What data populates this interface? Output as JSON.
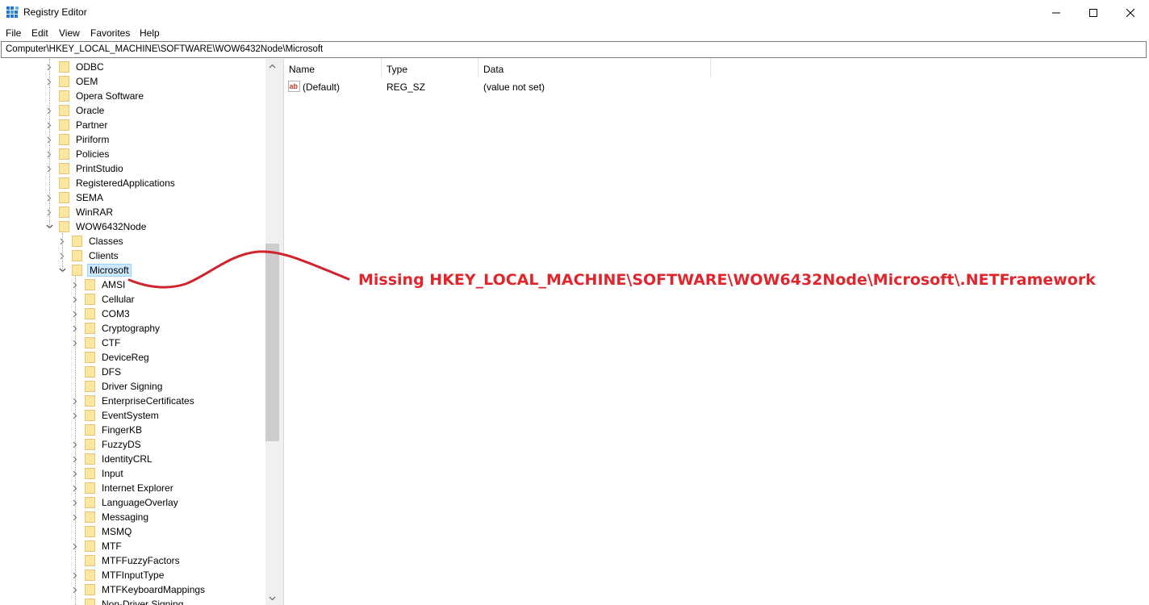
{
  "window": {
    "title": "Registry Editor",
    "minimize_icon": "minimize-icon",
    "maximize_icon": "maximize-icon",
    "close_icon": "close-icon"
  },
  "menu": [
    "File",
    "Edit",
    "View",
    "Favorites",
    "Help"
  ],
  "address": "Computer\\HKEY_LOCAL_MACHINE\\SOFTWARE\\WOW6432Node\\Microsoft",
  "tree": {
    "level1": [
      {
        "label": "ODBC",
        "expandable": true
      },
      {
        "label": "OEM",
        "expandable": true
      },
      {
        "label": "Opera Software",
        "expandable": false
      },
      {
        "label": "Oracle",
        "expandable": true
      },
      {
        "label": "Partner",
        "expandable": true
      },
      {
        "label": "Piriform",
        "expandable": true
      },
      {
        "label": "Policies",
        "expandable": true
      },
      {
        "label": "PrintStudio",
        "expandable": true
      },
      {
        "label": "RegisteredApplications",
        "expandable": false
      },
      {
        "label": "SEMA",
        "expandable": true
      },
      {
        "label": "WinRAR",
        "expandable": true
      },
      {
        "label": "WOW6432Node",
        "expandable": true,
        "expanded": true
      }
    ],
    "level2": [
      {
        "label": "Classes",
        "expandable": true
      },
      {
        "label": "Clients",
        "expandable": true
      },
      {
        "label": "Microsoft",
        "expandable": true,
        "expanded": true,
        "selected": true
      }
    ],
    "level3": [
      {
        "label": "AMSI",
        "expandable": true
      },
      {
        "label": "Cellular",
        "expandable": true
      },
      {
        "label": "COM3",
        "expandable": true
      },
      {
        "label": "Cryptography",
        "expandable": true
      },
      {
        "label": "CTF",
        "expandable": true
      },
      {
        "label": "DeviceReg",
        "expandable": false
      },
      {
        "label": "DFS",
        "expandable": false
      },
      {
        "label": "Driver Signing",
        "expandable": false
      },
      {
        "label": "EnterpriseCertificates",
        "expandable": true
      },
      {
        "label": "EventSystem",
        "expandable": true
      },
      {
        "label": "FingerKB",
        "expandable": false
      },
      {
        "label": "FuzzyDS",
        "expandable": true
      },
      {
        "label": "IdentityCRL",
        "expandable": true
      },
      {
        "label": "Input",
        "expandable": true
      },
      {
        "label": "Internet Explorer",
        "expandable": true
      },
      {
        "label": "LanguageOverlay",
        "expandable": true
      },
      {
        "label": "Messaging",
        "expandable": true
      },
      {
        "label": "MSMQ",
        "expandable": false
      },
      {
        "label": "MTF",
        "expandable": true
      },
      {
        "label": "MTFFuzzyFactors",
        "expandable": false
      },
      {
        "label": "MTFInputType",
        "expandable": true
      },
      {
        "label": "MTFKeyboardMappings",
        "expandable": true
      },
      {
        "label": "Non-Driver Signing",
        "expandable": false
      }
    ]
  },
  "list": {
    "columns": [
      "Name",
      "Type",
      "Data"
    ],
    "rows": [
      {
        "name": "(Default)",
        "type": "REG_SZ",
        "data": "(value not set)",
        "icon": "string-value-icon"
      }
    ]
  },
  "annotation": {
    "text": "Missing HKEY_LOCAL_MACHINE\\SOFTWARE\\WOW6432Node\\Microsoft\\.NETFramework",
    "color": "#e0262c"
  }
}
